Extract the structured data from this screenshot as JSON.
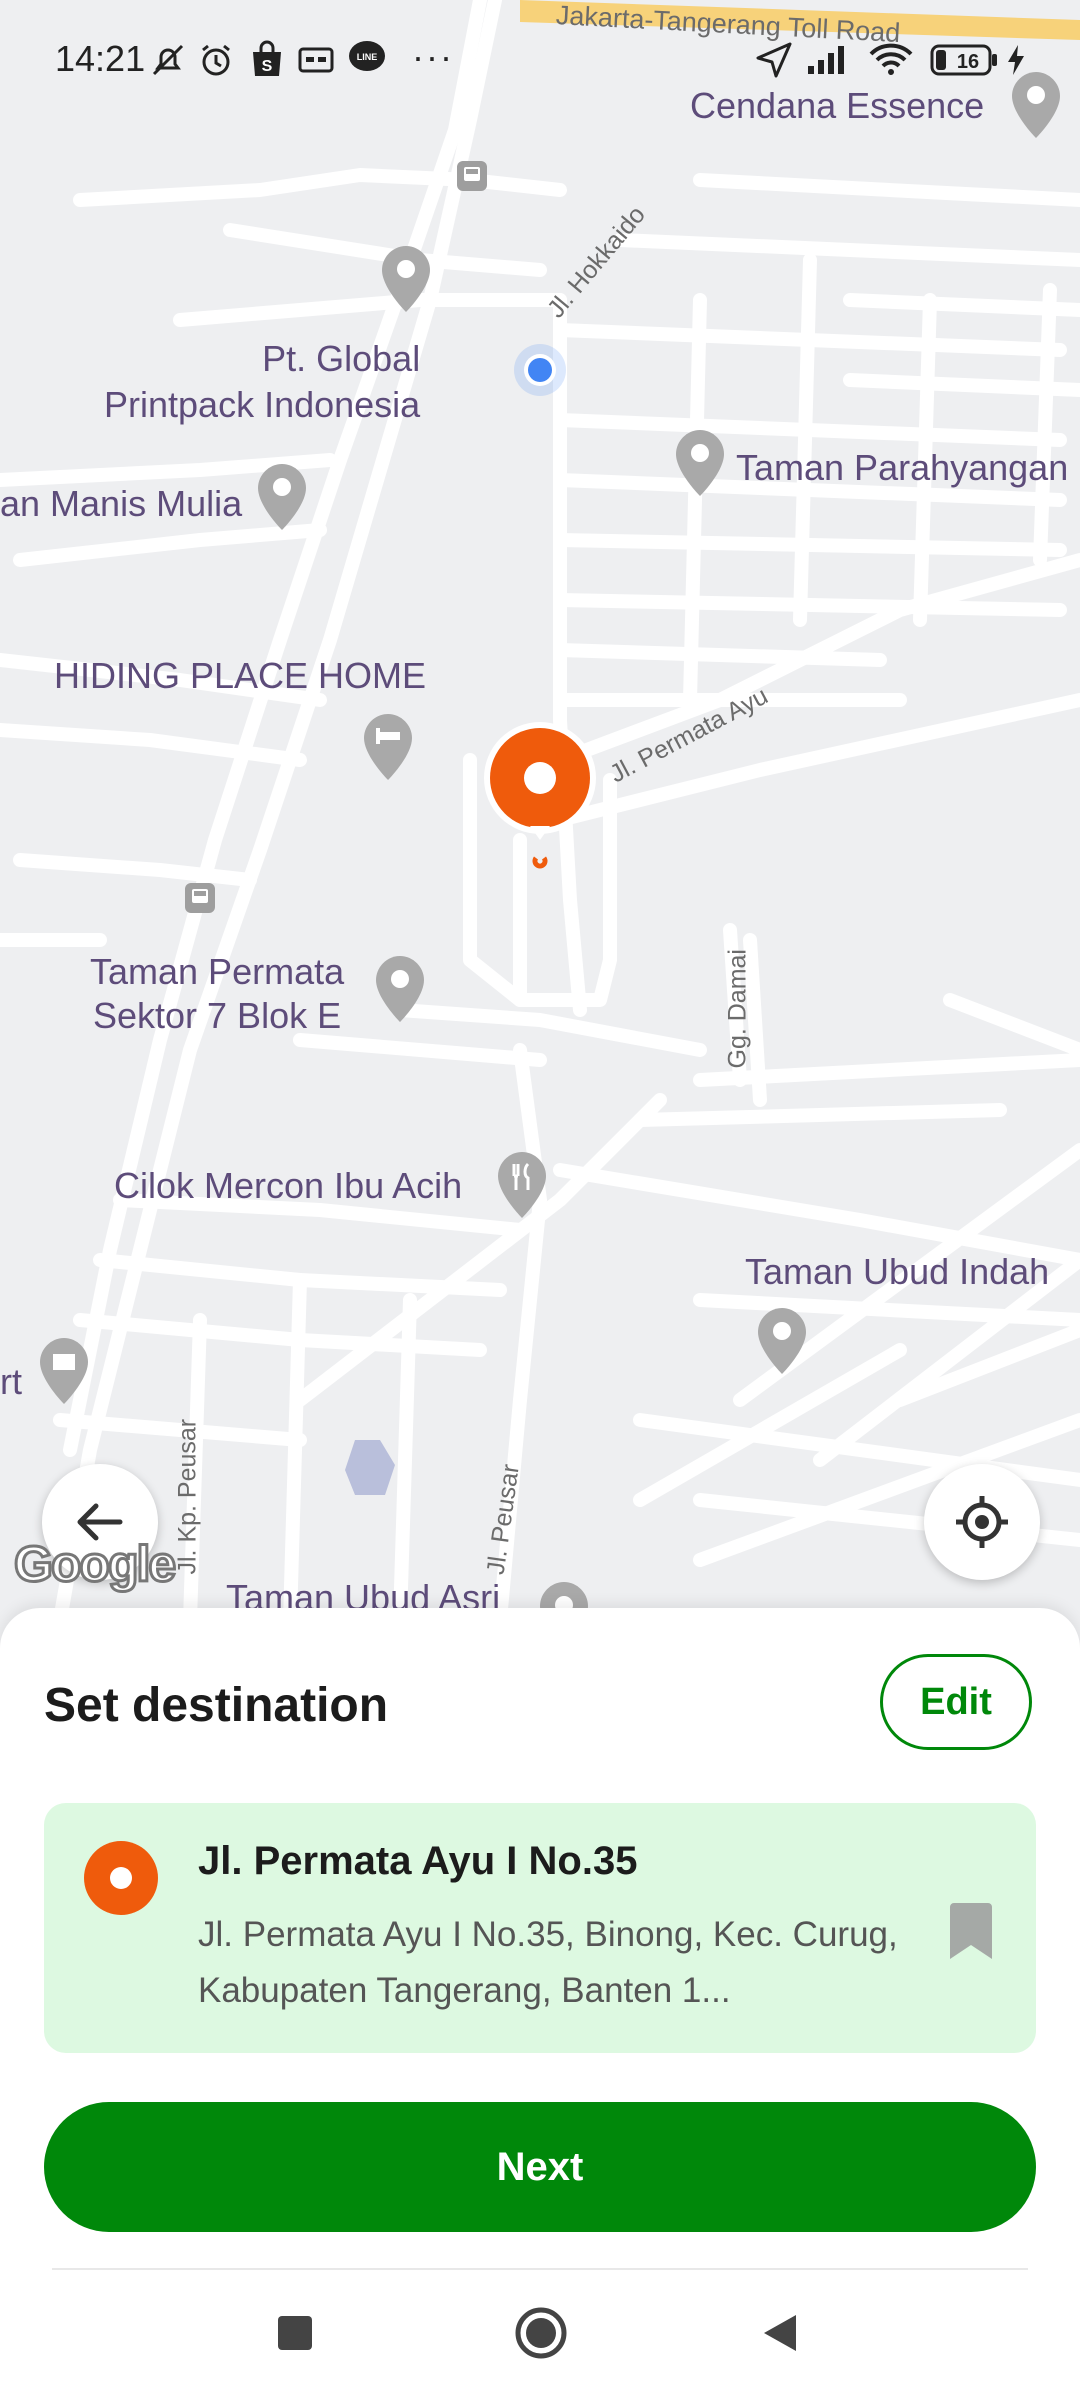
{
  "status_bar": {
    "time": "14:21",
    "battery": "16",
    "overflow": "···",
    "icons": [
      "silent-bell-icon",
      "alarm-icon",
      "shop-icon",
      "card-icon",
      "line-icon",
      "location-arrow-icon",
      "signal-icon",
      "wifi-icon",
      "battery-icon",
      "charging-icon"
    ]
  },
  "map": {
    "road_top": "Jakarta-Tangerang Toll Road",
    "streets": {
      "hokkaido": "Jl. Hokkaido",
      "permata_ayu": "Jl. Permata Ayu",
      "gg_damai": "Gg. Damai",
      "kp_peusar": "Jl. Kp. Peusar",
      "peusar": "Jl. Peusar"
    },
    "places": {
      "cendana": "Cendana Essence",
      "global_printpack": "Pt. Global\nPrintpack Indonesia",
      "taman_parahyangan": "Taman Parahyangan",
      "manis_mulia": "an Manis Mulia",
      "hiding_place": "HIDING PLACE HOME",
      "taman_permata": "Taman Permata\nSektor 7 Blok E",
      "cilok_mercon": "Cilok Mercon Ibu Acih",
      "taman_ubud_indah": "Taman Ubud Indah",
      "rt": "rt",
      "taman_ubud_asri": "Taman Ubud Asri"
    },
    "attribution": "Google",
    "colors": {
      "road": "#ffffff",
      "background": "#eeeff1",
      "highway": "#f7d27a",
      "poi_pin": "#a9a9a9",
      "destination": "#ef5b0c",
      "current_location": "#4285f4"
    }
  },
  "sheet": {
    "title": "Set destination",
    "edit_label": "Edit",
    "destination": {
      "name": "Jl. Permata Ayu I No.35",
      "address": "Jl. Permata Ayu I No.35, Binong, Kec. Curug, Kabupaten Tangerang, Banten 1..."
    },
    "next_label": "Next",
    "colors": {
      "primary": "#00880a",
      "card_bg": "#ddf9e1"
    }
  },
  "nav_bar": {
    "icons": [
      "recents-square-icon",
      "home-circle-icon",
      "back-triangle-icon"
    ]
  }
}
